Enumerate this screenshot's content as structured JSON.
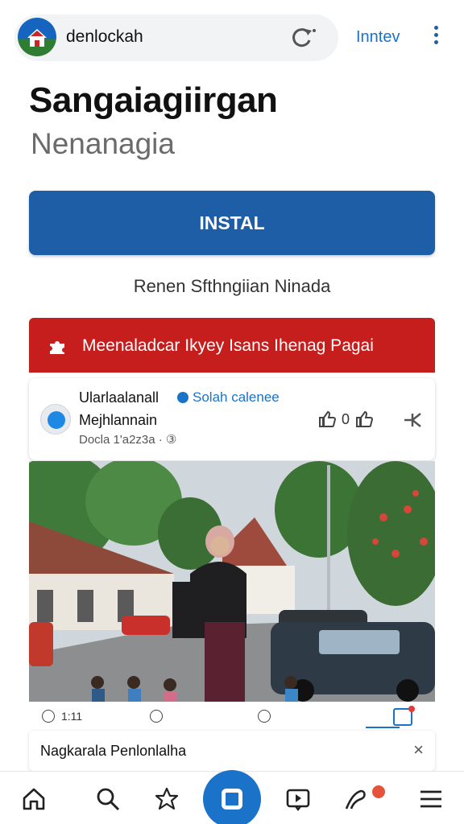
{
  "topbar": {
    "site_name": "denlockah",
    "action_label": "Inntev"
  },
  "header": {
    "title": "Sangaiagiirgan",
    "subtitle": "Nenanagia"
  },
  "install_button": "INSTAL",
  "secondary_link": "Renen Sfthngiian Ninada",
  "banner": {
    "text": "Meenaladcar Ikyey Isans Ihenag Pagai",
    "color": "#c61d1d"
  },
  "post": {
    "author": "Ularlaalanall",
    "verified_label": "Solah calenee",
    "page_name": "Mejhlannain",
    "date": "Docla 1'a2z3a · ③",
    "like_count": "0"
  },
  "stats": {
    "views": "1:11"
  },
  "notice": {
    "text": "Nagkarala Penlonlalha",
    "close": "×"
  },
  "colors": {
    "accent": "#1a73c8",
    "install": "#1d5ea6"
  },
  "nav": {
    "items": [
      "home-icon",
      "search-icon",
      "star-icon",
      "center-action-icon",
      "video-icon",
      "activity-icon",
      "menu-icon"
    ]
  }
}
